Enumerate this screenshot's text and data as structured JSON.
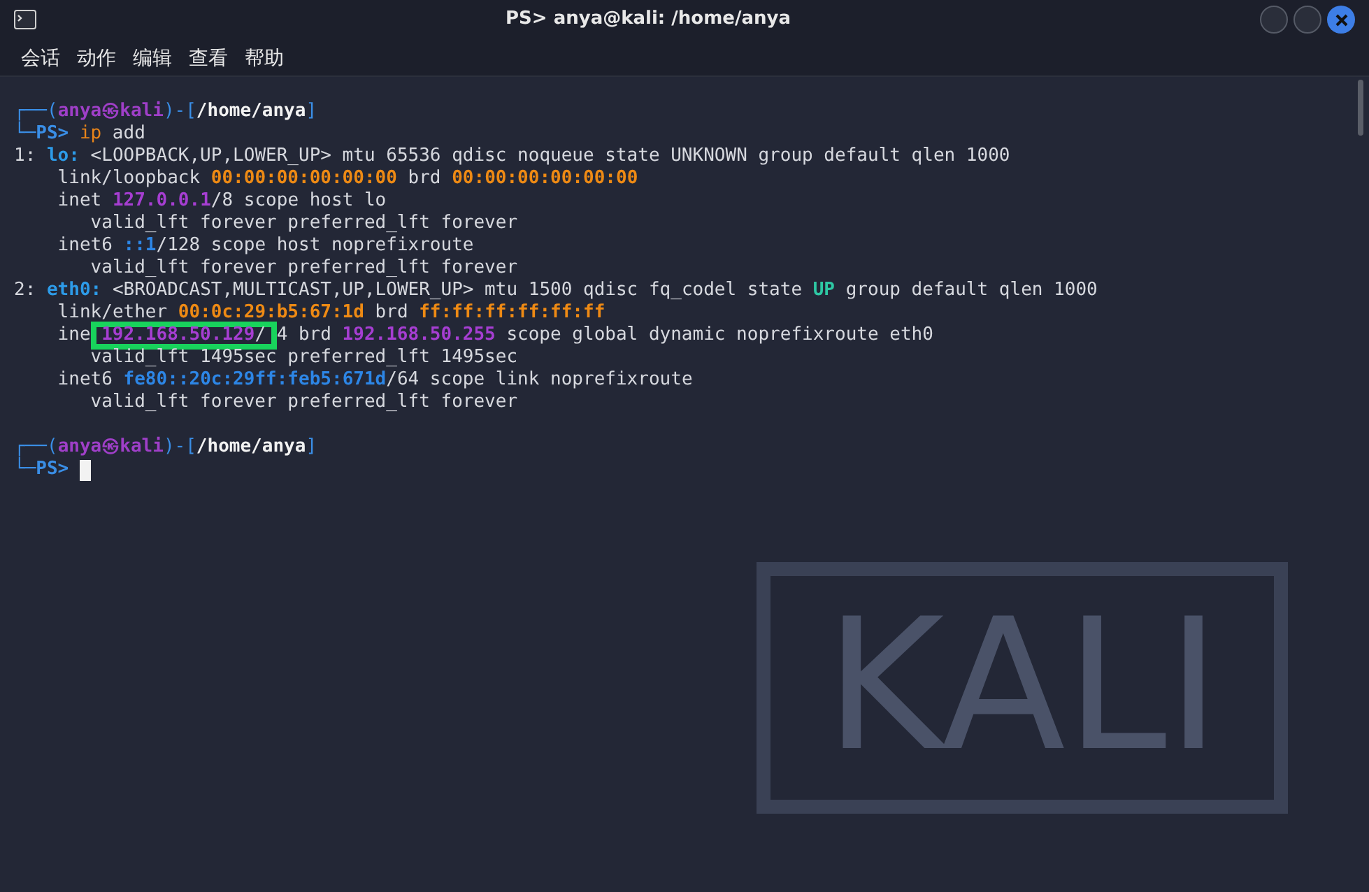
{
  "window": {
    "title": "PS> anya@kali: /home/anya"
  },
  "menu": [
    {
      "label": "会话"
    },
    {
      "label": "动作"
    },
    {
      "label": "编辑"
    },
    {
      "label": "查看"
    },
    {
      "label": "帮助"
    }
  ],
  "terminal": {
    "lines": [
      {
        "segments": [
          {
            "kind": "frame",
            "text": "┌──("
          },
          {
            "kind": "user",
            "text": "anya㉿kali"
          },
          {
            "kind": "frame",
            "text": ")-["
          },
          {
            "kind": "path",
            "text": "/home/anya"
          },
          {
            "kind": "frame",
            "text": "]"
          }
        ]
      },
      {
        "segments": [
          {
            "kind": "frame",
            "text": "└─"
          },
          {
            "kind": "prompt",
            "text": "PS>"
          },
          {
            "kind": "cmd",
            "text": "ip"
          },
          {
            "kind": "plain",
            "text": " add"
          }
        ]
      },
      {
        "segments": [
          {
            "kind": "plain",
            "text": "1: "
          },
          {
            "kind": "iface",
            "text": "lo:"
          },
          {
            "kind": "plain",
            "text": " <LOOPBACK,UP,LOWER_UP> mtu 65536 qdisc noqueue state UNKNOWN group default qlen 1000"
          }
        ]
      },
      {
        "segments": [
          {
            "kind": "plain",
            "text": "    link/loopback "
          },
          {
            "kind": "mac",
            "text": "00:00:00:00:00:00"
          },
          {
            "kind": "plain",
            "text": " brd "
          },
          {
            "kind": "mac",
            "text": "00:00:00:00:00:00"
          }
        ]
      },
      {
        "segments": [
          {
            "kind": "plain",
            "text": "    inet "
          },
          {
            "kind": "ip4",
            "text": "127.0.0.1"
          },
          {
            "kind": "plain",
            "text": "/8 scope host lo"
          }
        ]
      },
      {
        "segments": [
          {
            "kind": "plain",
            "text": "       valid_lft forever preferred_lft forever"
          }
        ]
      },
      {
        "segments": [
          {
            "kind": "plain",
            "text": "    inet6 "
          },
          {
            "kind": "ip6",
            "text": "::1"
          },
          {
            "kind": "plain",
            "text": "/128 scope host noprefixroute"
          }
        ]
      },
      {
        "segments": [
          {
            "kind": "plain",
            "text": "       valid_lft forever preferred_lft forever"
          }
        ]
      },
      {
        "segments": [
          {
            "kind": "plain",
            "text": "2: "
          },
          {
            "kind": "iface",
            "text": "eth0:"
          },
          {
            "kind": "plain",
            "text": " <BROADCAST,MULTICAST,UP,LOWER_UP> mtu 1500 qdisc fq_codel state "
          },
          {
            "kind": "up",
            "text": "UP"
          },
          {
            "kind": "plain",
            "text": " group default qlen 1000"
          }
        ]
      },
      {
        "segments": [
          {
            "kind": "plain",
            "text": "    link/ether "
          },
          {
            "kind": "mac",
            "text": "00:0c:29:b5:67:1d"
          },
          {
            "kind": "plain",
            "text": " brd "
          },
          {
            "kind": "mac",
            "text": "ff:ff:ff:ff:ff:ff"
          }
        ]
      },
      {
        "segments": [
          {
            "kind": "plain",
            "text": "    ine"
          },
          {
            "kind": "ip4",
            "text": "192.168.50.129",
            "highlighted": true
          },
          {
            "kind": "plain",
            "text": "/",
            "highlighted": true
          },
          {
            "kind": "plain",
            "text": "4 brd "
          },
          {
            "kind": "ip4",
            "text": "192.168.50.255"
          },
          {
            "kind": "plain",
            "text": " scope global dynamic noprefixroute eth0"
          }
        ]
      },
      {
        "segments": [
          {
            "kind": "plain",
            "text": "       valid_lft 1495sec preferred_lft 1495sec"
          }
        ]
      },
      {
        "segments": [
          {
            "kind": "plain",
            "text": "    inet6 "
          },
          {
            "kind": "ip6",
            "text": "fe80::20c:29ff:feb5:671d"
          },
          {
            "kind": "plain",
            "text": "/64 scope link noprefixroute"
          }
        ]
      },
      {
        "segments": [
          {
            "kind": "plain",
            "text": "       valid_lft forever preferred_lft forever"
          }
        ]
      },
      {
        "spaced": true,
        "segments": [
          {
            "kind": "frame",
            "text": "┌──("
          },
          {
            "kind": "user",
            "text": "anya㉿kali"
          },
          {
            "kind": "frame",
            "text": ")-["
          },
          {
            "kind": "path",
            "text": "/home/anya"
          },
          {
            "kind": "frame",
            "text": "]"
          }
        ]
      },
      {
        "cursor": true,
        "segments": [
          {
            "kind": "frame",
            "text": "└─"
          },
          {
            "kind": "prompt",
            "text": "PS>"
          }
        ]
      }
    ]
  },
  "background_logo": {
    "text": "KALI"
  }
}
